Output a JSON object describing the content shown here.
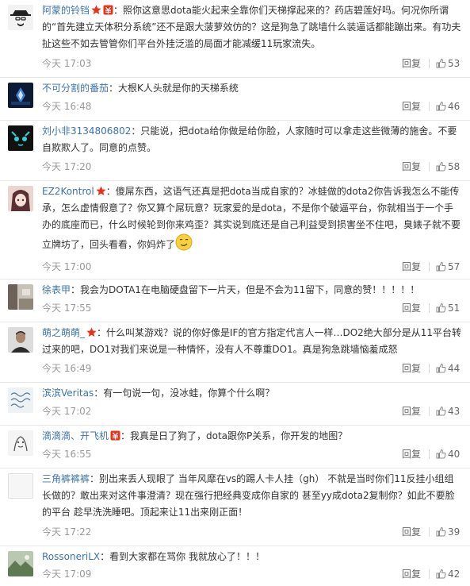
{
  "comments": [
    {
      "user": "阿蒙的铃铛",
      "text": "：照你这意思dota能火起来全靠你们天梯撑起来的？药店碧莲好吗。何况你所谓的“首先建立天体积分系统”还不是跟大菠萝效仿的？这是狗急了跳墙什么装逼话都能蹦出来。有功夫扯这些不如去管管你们平台外挂泛滥的局面才能减缓11玩家流失。",
      "time": "今天 17:03",
      "reply": "回复",
      "likes": "53",
      "avatar": "heisenberg-avatar"
    },
    {
      "user": "不可分割的番茄",
      "text": "：大根K人头就是你的天梯系统",
      "time": "今天 16:48",
      "reply": "回复",
      "likes": "46",
      "avatar": "dark-game-avatar"
    },
    {
      "user": "刘小非3134806802",
      "text": "：只能说，把dota给你做是给你脸，人家随时可以拿走这些微薄的施舍。不要自欺欺人了。同意的点赞。",
      "time": "今天 17:20",
      "reply": "回复",
      "likes": "58",
      "avatar": "cat-face-avatar"
    },
    {
      "user": "EZ2Kontrol",
      "text": "：傻屌东西，这语气还真是把dota当成自家的？冰蛙做的dota2你告诉我怎么不能传承，怎么虚情假意了？你又算个屌玩意？玩家爱的是dota，不是你个破逼平台，你就相当于一个手办的底座而已，什么时候轮到你来鸡歪？其实说到底还是自己利益受到损害坐不住吧，臭婊子就不要立牌坊了，回头看看，你妈炸了",
      "time": "今天 17:00",
      "reply": "回复",
      "likes": "57",
      "avatar": "anime-girl-avatar"
    },
    {
      "user": "徐表甲",
      "text": "：我会为DOTA1在电脑硬盘留下一片天，但是不会为11留下，同意的赞！！！！！",
      "time": "今天 17:55",
      "reply": "回复",
      "likes": "51",
      "avatar": "room-photo-avatar"
    },
    {
      "user": "萌之萌萌_",
      "text": "：什么叫某游戏？说的你好像是IF的官方指定代言人一样…DO2绝大部分是从11平台转过来的吧，DO1对我们来说是一种情怀，没有人不尊重DO1。真是狗急跳墙恼羞成怒",
      "time": "今天 16:49",
      "reply": "回复",
      "likes": "44",
      "avatar": "man-portrait-avatar"
    },
    {
      "user": "滨滨Veritas",
      "text": "：有一句说一句，没冰蛙，你算个什么啊？",
      "time": "今天 17:02",
      "reply": "回复",
      "likes": "43",
      "avatar": "handwriting-avatar"
    },
    {
      "user": "滴滴滴、开飞机",
      "text": "：我真是日了狗了，dota跟你P关系，你开发的地图？",
      "time": "今天 16:55",
      "reply": "回复",
      "likes": "40",
      "avatar": "sketch-avatar"
    },
    {
      "user": "三角裤裤裤",
      "text": "：别出来丢人现眼了 当年风靡在vs的踢人卡人挂（gh） 不就是当时你们11反挂小组组长做的？敢出来对这件事澄清？现在强行把经典变成你自家的 甚至yy成dota2复制你？如此不要脸的平台 趁早洗洗睡吧。顶起来让11出来刚正面！",
      "time": "今天 17:22",
      "reply": "回复",
      "likes": "39",
      "avatar": "blank-avatar"
    },
    {
      "user": "RossoneriLX",
      "text": "：看到大家都在骂你 我就放心了！！！",
      "time": "今天 17:09",
      "reply": "回复",
      "likes": "42",
      "avatar": "landscape-avatar"
    }
  ]
}
